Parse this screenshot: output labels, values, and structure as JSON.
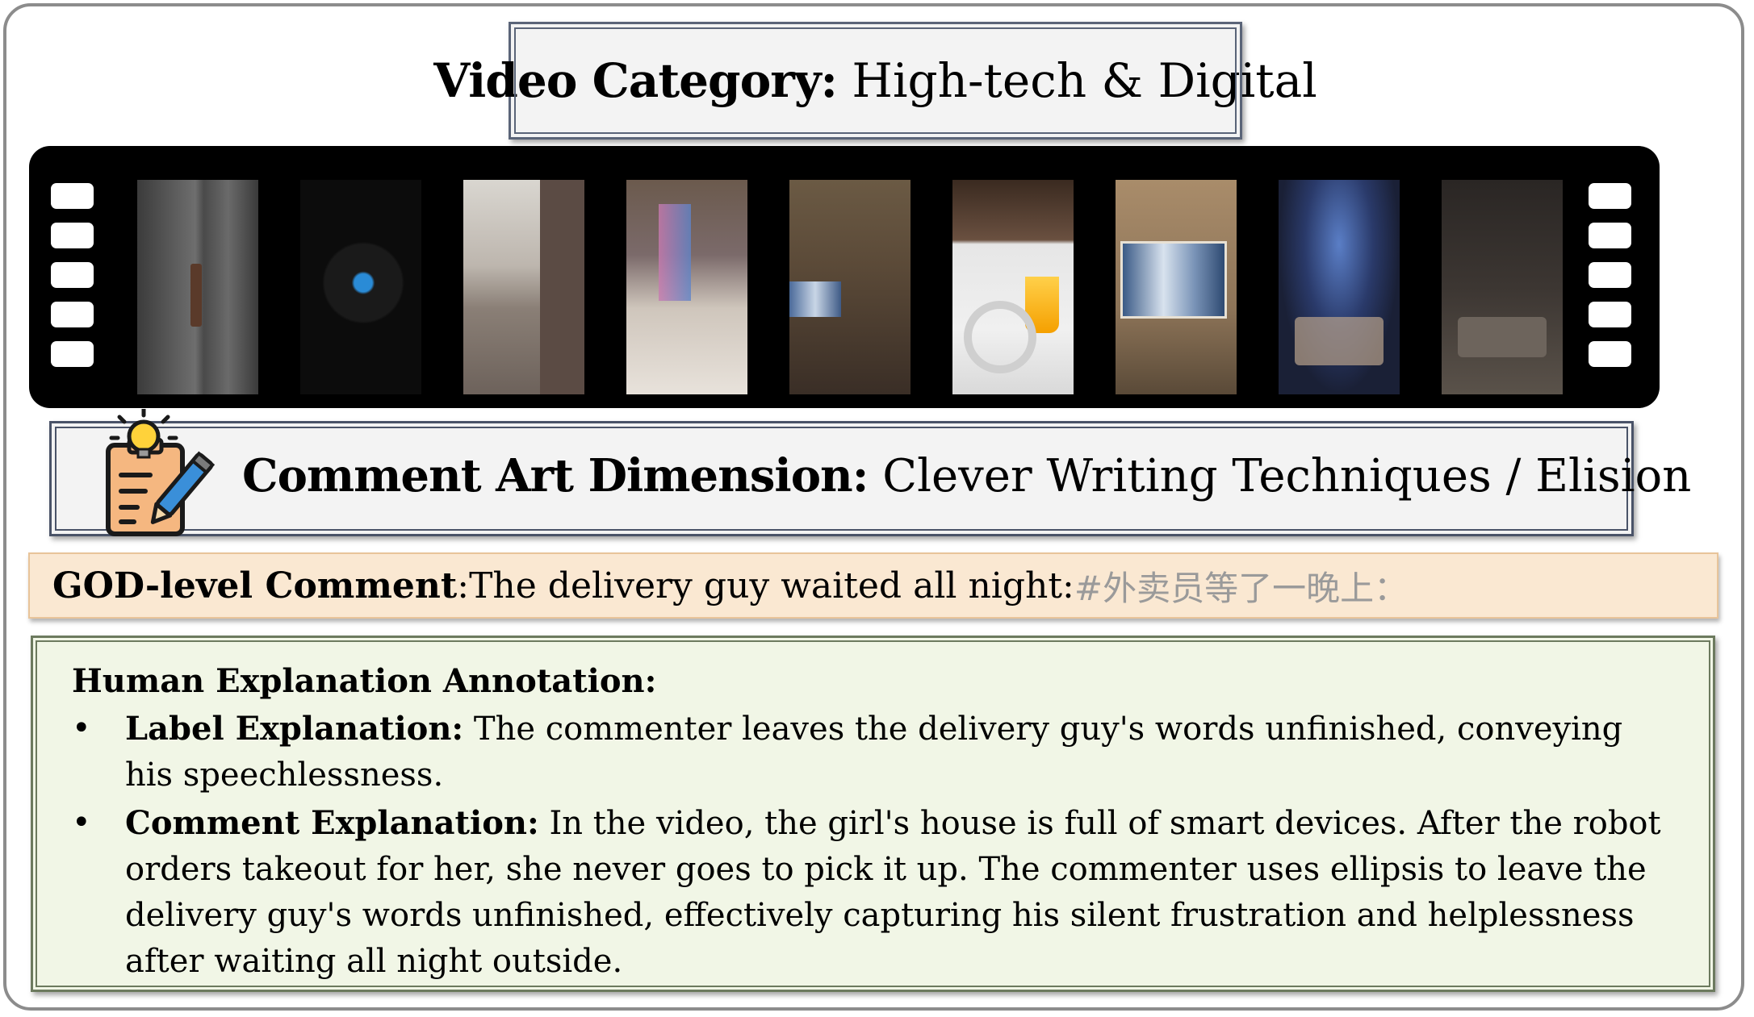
{
  "header": {
    "video_category_label": "Video Category:",
    "video_category_value": "High-tech & Digital"
  },
  "filmstrip": {
    "frame_count": 9,
    "hole_count_per_side": 5
  },
  "dimension": {
    "label": "Comment Art Dimension:",
    "value": "Clever Writing Techniques / Elision",
    "icon": "idea-writing-icon"
  },
  "god_comment": {
    "label": "GOD-level Comment",
    "separator": ": ",
    "text": "The delivery guy waited all night: ",
    "original_text": "#外卖员等了一晚上："
  },
  "annotation": {
    "heading": "Human Explanation Annotation:",
    "items": [
      {
        "bullet": "•",
        "label": "Label Explanation:",
        "text": "The commenter leaves the delivery guy's words unfinished, conveying his speechlessness."
      },
      {
        "bullet": "•",
        "label": "Comment Explanation:",
        "text": "In the video, the girl's house is full of smart devices. After the robot orders takeout for her, she never goes to pick it up. The commenter uses ellipsis to leave the delivery guy's words unfinished, effectively capturing his silent frustration and helplessness after waiting all night outside."
      }
    ]
  }
}
